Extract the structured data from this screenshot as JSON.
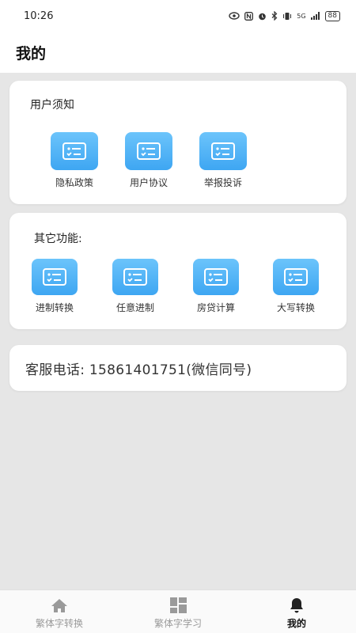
{
  "status_bar": {
    "time": "10:26",
    "signal_label": "5G",
    "battery": "88"
  },
  "header": {
    "title": "我的"
  },
  "notice_card": {
    "title": "用户须知",
    "items": [
      {
        "label": "隐私政策",
        "icon": "list-doc-icon"
      },
      {
        "label": "用户协议",
        "icon": "list-doc-icon"
      },
      {
        "label": "举报投诉",
        "icon": "list-doc-icon"
      }
    ]
  },
  "functions_card": {
    "title": "其它功能:",
    "items": [
      {
        "label": "进制转换",
        "icon": "list-doc-icon"
      },
      {
        "label": "任意进制",
        "icon": "list-doc-icon"
      },
      {
        "label": "房贷计算",
        "icon": "list-doc-icon"
      },
      {
        "label": "大写转换",
        "icon": "list-doc-icon"
      }
    ]
  },
  "phone_card": {
    "text": "客服电话: 15861401751(微信同号)"
  },
  "tabs": [
    {
      "label": "繁体字转换",
      "icon": "home-icon",
      "active": false
    },
    {
      "label": "繁体字学习",
      "icon": "grid-icon",
      "active": false
    },
    {
      "label": "我的",
      "icon": "bell-icon",
      "active": true
    }
  ],
  "colors": {
    "accent": "#4aaef5",
    "background": "#e6e6e6",
    "card": "#ffffff"
  }
}
